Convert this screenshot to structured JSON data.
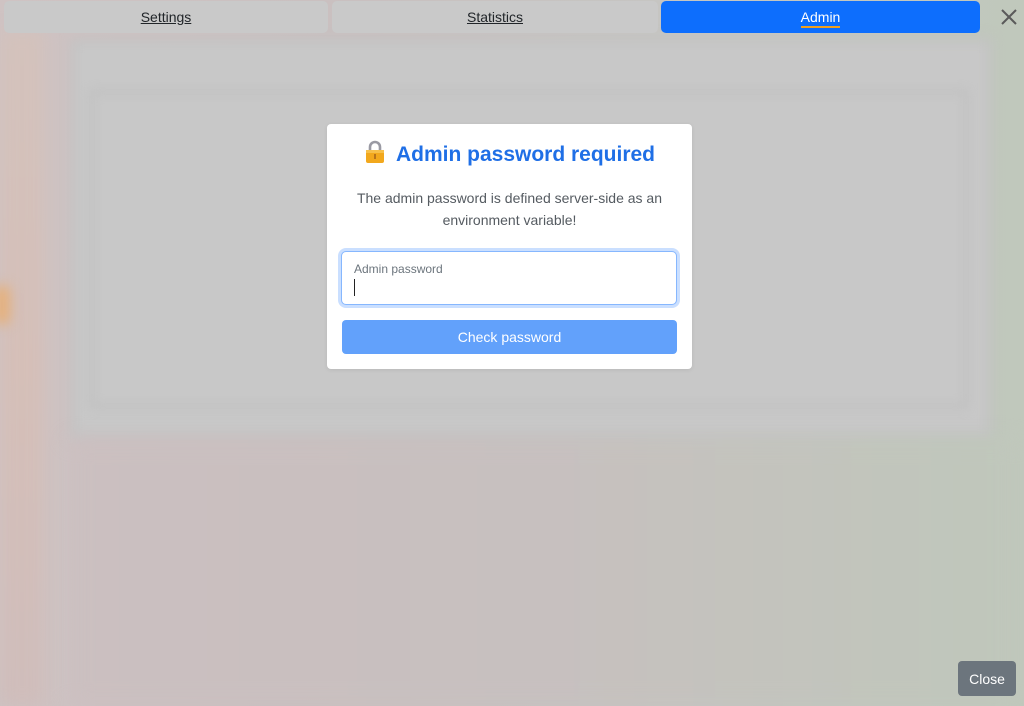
{
  "tabs": [
    {
      "label": "Settings",
      "active": false
    },
    {
      "label": "Statistics",
      "active": false
    },
    {
      "label": "Admin",
      "active": true
    }
  ],
  "colors": {
    "accent": "#0d6efd",
    "title": "#1f6fe6",
    "button": "#62a1fb",
    "close_button": "#6c757d"
  },
  "modal": {
    "title": "Admin password required",
    "title_icon": "lock-icon",
    "description": "The admin password is defined server-side as an environment variable!",
    "field": {
      "label": "Admin password",
      "value": ""
    },
    "submit_label": "Check password"
  },
  "footer": {
    "close_label": "Close"
  },
  "icons": {
    "window_close": "close-icon"
  }
}
